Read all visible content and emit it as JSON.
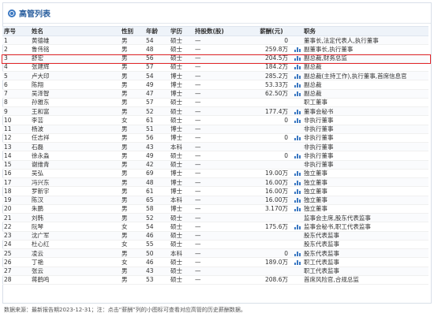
{
  "panel": {
    "title": "高管列表"
  },
  "columns": {
    "idx": "序号",
    "name": "姓名",
    "sex": "性别",
    "age": "年龄",
    "edu": "学历",
    "hold": "持股数(股)",
    "salary": "薪酬(元)",
    "position": "职务"
  },
  "rows": [
    {
      "idx": "1",
      "name": "黄德雄",
      "sex": "男",
      "age": "54",
      "edu": "硕士",
      "hold": "—",
      "salary": "0",
      "chart": false,
      "position": "董事长,法定代表人,执行董事"
    },
    {
      "idx": "2",
      "name": "鲁伟铭",
      "sex": "男",
      "age": "48",
      "edu": "硕士",
      "hold": "—",
      "salary": "259.8万",
      "chart": true,
      "position": "副董事长,执行董事"
    },
    {
      "idx": "3",
      "name": "舒宏",
      "sex": "男",
      "age": "56",
      "edu": "硕士",
      "hold": "—",
      "salary": "204.5万",
      "chart": true,
      "position": "副总裁,财务总监"
    },
    {
      "idx": "4",
      "name": "张建辉",
      "sex": "男",
      "age": "57",
      "edu": "硕士",
      "hold": "—",
      "salary": "184.2万",
      "chart": true,
      "position": "副总裁"
    },
    {
      "idx": "5",
      "name": "卢大印",
      "sex": "男",
      "age": "54",
      "edu": "博士",
      "hold": "—",
      "salary": "285.2万",
      "chart": true,
      "position": "副总裁(主持工作),执行董事,首席信息官"
    },
    {
      "idx": "6",
      "name": "陈翔",
      "sex": "男",
      "age": "49",
      "edu": "博士",
      "hold": "—",
      "salary": "53.33万",
      "chart": true,
      "position": "副总裁"
    },
    {
      "idx": "7",
      "name": "吴泽智",
      "sex": "男",
      "age": "47",
      "edu": "博士",
      "hold": "—",
      "salary": "62.50万",
      "chart": true,
      "position": "副总裁"
    },
    {
      "idx": "8",
      "name": "孙雅东",
      "sex": "男",
      "age": "57",
      "edu": "硕士",
      "hold": "—",
      "salary": "",
      "chart": false,
      "position": "职工董事"
    },
    {
      "idx": "9",
      "name": "王和富",
      "sex": "男",
      "age": "52",
      "edu": "硕士",
      "hold": "—",
      "salary": "177.4万",
      "chart": true,
      "position": "董事会秘书"
    },
    {
      "idx": "10",
      "name": "李芸",
      "sex": "女",
      "age": "61",
      "edu": "硕士",
      "hold": "—",
      "salary": "0",
      "chart": true,
      "position": "非执行董事"
    },
    {
      "idx": "11",
      "name": "杨波",
      "sex": "男",
      "age": "51",
      "edu": "博士",
      "hold": "—",
      "salary": "",
      "chart": false,
      "position": "非执行董事"
    },
    {
      "idx": "12",
      "name": "任志祥",
      "sex": "男",
      "age": "56",
      "edu": "博士",
      "hold": "—",
      "salary": "0",
      "chart": true,
      "position": "非执行董事"
    },
    {
      "idx": "13",
      "name": "石磊",
      "sex": "男",
      "age": "43",
      "edu": "本科",
      "hold": "—",
      "salary": "",
      "chart": false,
      "position": "非执行董事"
    },
    {
      "idx": "14",
      "name": "徐永淼",
      "sex": "男",
      "age": "49",
      "edu": "硕士",
      "hold": "—",
      "salary": "0",
      "chart": true,
      "position": "非执行董事"
    },
    {
      "idx": "15",
      "name": "谢维青",
      "sex": "男",
      "age": "42",
      "edu": "硕士",
      "hold": "—",
      "salary": "",
      "chart": false,
      "position": "非执行董事"
    },
    {
      "idx": "16",
      "name": "吴弘",
      "sex": "男",
      "age": "69",
      "edu": "博士",
      "hold": "—",
      "salary": "19.00万",
      "chart": true,
      "position": "独立董事"
    },
    {
      "idx": "17",
      "name": "冯兴东",
      "sex": "男",
      "age": "48",
      "edu": "博士",
      "hold": "—",
      "salary": "16.00万",
      "chart": true,
      "position": "独立董事"
    },
    {
      "idx": "18",
      "name": "罗新宇",
      "sex": "男",
      "age": "61",
      "edu": "博士",
      "hold": "—",
      "salary": "16.00万",
      "chart": true,
      "position": "独立董事"
    },
    {
      "idx": "19",
      "name": "陈汉",
      "sex": "男",
      "age": "65",
      "edu": "本科",
      "hold": "—",
      "salary": "16.00万",
      "chart": true,
      "position": "独立董事"
    },
    {
      "idx": "20",
      "name": "朱鹏",
      "sex": "男",
      "age": "58",
      "edu": "博士",
      "hold": "—",
      "salary": "3.170万",
      "chart": true,
      "position": "独立董事"
    },
    {
      "idx": "21",
      "name": "刘韩",
      "sex": "男",
      "age": "52",
      "edu": "硕士",
      "hold": "—",
      "salary": "",
      "chart": false,
      "position": "监事会主席,股东代表监事"
    },
    {
      "idx": "22",
      "name": "阮琴",
      "sex": "女",
      "age": "54",
      "edu": "硕士",
      "hold": "—",
      "salary": "175.6万",
      "chart": true,
      "position": "监事会秘书,职工代表监事"
    },
    {
      "idx": "23",
      "name": "沈广军",
      "sex": "男",
      "age": "46",
      "edu": "硕士",
      "hold": "—",
      "salary": "",
      "chart": false,
      "position": "股东代表监事"
    },
    {
      "idx": "24",
      "name": "杜心红",
      "sex": "女",
      "age": "55",
      "edu": "硕士",
      "hold": "—",
      "salary": "",
      "chart": false,
      "position": "股东代表监事"
    },
    {
      "idx": "25",
      "name": "凌云",
      "sex": "男",
      "age": "50",
      "edu": "本科",
      "hold": "—",
      "salary": "0",
      "chart": true,
      "position": "股东代表监事"
    },
    {
      "idx": "26",
      "name": "丁艳",
      "sex": "女",
      "age": "46",
      "edu": "硕士",
      "hold": "—",
      "salary": "189.0万",
      "chart": true,
      "position": "职工代表监事"
    },
    {
      "idx": "27",
      "name": "张云",
      "sex": "男",
      "age": "43",
      "edu": "硕士",
      "hold": "—",
      "salary": "",
      "chart": false,
      "position": "职工代表监事"
    },
    {
      "idx": "28",
      "name": "蒋鹤鸣",
      "sex": "男",
      "age": "53",
      "edu": "硕士",
      "hold": "—",
      "salary": "208.6万",
      "chart": false,
      "position": "首席风险官,合规总监"
    }
  ],
  "highlight_row": 3,
  "footnote": "数据来源：最新报告期2023-12-31；注：点击“薪酬”列的小图标可查看对应高管的历史薪酬数据。",
  "colors": {
    "accent": "#3b78c2",
    "highlight": "#e3262a",
    "header_bg": "#eef3f9"
  },
  "chart_data": {
    "type": "table",
    "columns": [
      "序号",
      "姓名",
      "性别",
      "年龄",
      "学历",
      "持股数(股)",
      "薪酬(元)",
      "职务"
    ],
    "title": "高管列表"
  }
}
